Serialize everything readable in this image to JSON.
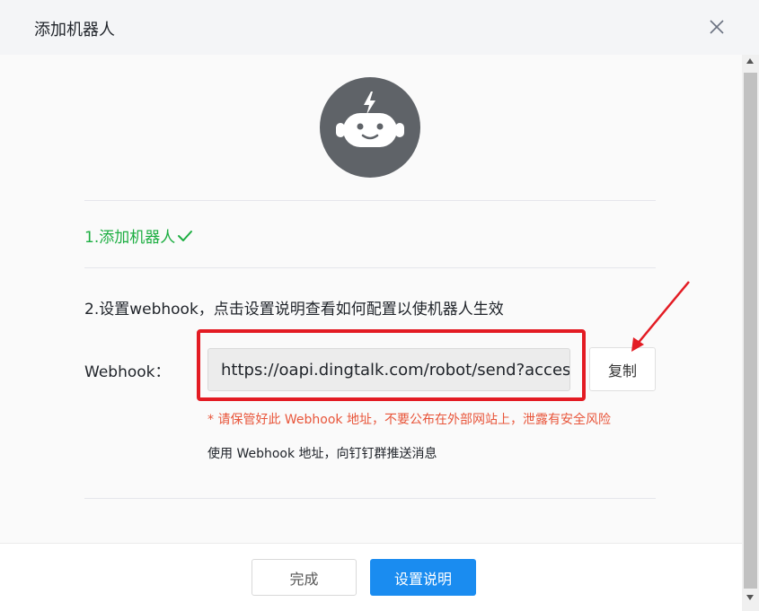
{
  "dialog": {
    "title": "添加机器人",
    "close_icon": "close-icon"
  },
  "avatar": {
    "icon": "robot-icon",
    "bg_color": "#5f6368"
  },
  "steps": {
    "step1_label": "1.添加机器人",
    "step1_status_icon": "checkmark-icon",
    "step2_label": "2.设置webhook，点击设置说明查看如何配置以使机器人生效"
  },
  "webhook": {
    "label": "Webhook：",
    "value": "https://oapi.dingtalk.com/robot/send?access_token=",
    "copy_label": "复制",
    "warning": "* 请保管好此 Webhook 地址，不要公布在外部网站上，泄露有安全风险",
    "usage": "使用 Webhook 地址，向钉钉群推送消息"
  },
  "footer": {
    "done_label": "完成",
    "settings_label": "设置说明"
  },
  "colors": {
    "success": "#1dae42",
    "warning": "#e8553a",
    "primary": "#1a8cf0",
    "annotation": "#e31b23"
  }
}
